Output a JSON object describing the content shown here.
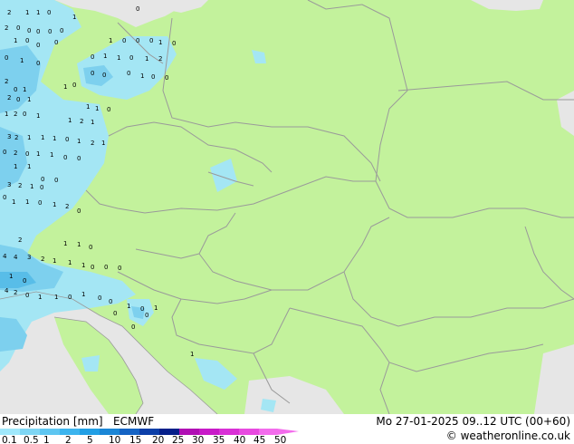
{
  "footer": {
    "title": "Precipitation [mm]",
    "model": "ECMWF",
    "forecast_time": "Mo 27-01-2025 09..12 UTC (00+60)",
    "credit": "© weatheronline.co.uk"
  },
  "legend": {
    "ticks": [
      "0.1",
      "0.5",
      "1",
      "2",
      "5",
      "10",
      "15",
      "20",
      "25",
      "30",
      "35",
      "40",
      "45",
      "50"
    ],
    "colors": [
      "#9fe8fb",
      "#7fd6f4",
      "#5ec6f1",
      "#3cb4ee",
      "#229fe5",
      "#1a86d6",
      "#1463c4",
      "#0c3fa8",
      "#061f8a",
      "#b00fb4",
      "#c81ac8",
      "#d930d6",
      "#e84ae0",
      "#f36cec"
    ]
  },
  "map": {
    "colors": {
      "land": "#c3f29c",
      "sea": "#e6e6e6",
      "precip_light": "#a4e6f4",
      "precip_mid": "#7dd0ee",
      "precip_heavy": "#58bde8",
      "border": "#9a9a9a"
    }
  },
  "station_values": [
    "2",
    "1",
    "1",
    "0",
    "1",
    "2",
    "0",
    "0",
    "0",
    "0",
    "0",
    "1",
    "0",
    "0",
    "0",
    "0",
    "1",
    "0",
    "0",
    "0",
    "1",
    "0",
    "0",
    "1",
    "1",
    "0",
    "1",
    "2",
    "0",
    "1",
    "0",
    "1",
    "0",
    "0",
    "0",
    "0",
    "1",
    "0",
    "0",
    "2",
    "0",
    "1",
    "2",
    "0",
    "1",
    "1",
    "1",
    "0",
    "1",
    "2",
    "0",
    "1",
    "1",
    "2",
    "1",
    "3",
    "2",
    "1",
    "1",
    "1",
    "0",
    "1",
    "2",
    "1",
    "0",
    "2",
    "0",
    "1",
    "1",
    "0",
    "0",
    "1",
    "1",
    "0",
    "0",
    "3",
    "2",
    "1",
    "0",
    "0",
    "1",
    "1",
    "0",
    "1",
    "2",
    "0",
    "2",
    "1",
    "1",
    "0",
    "4",
    "4",
    "3",
    "2",
    "1",
    "1",
    "1",
    "0",
    "0",
    "0",
    "1",
    "0",
    "4",
    "2",
    "0",
    "1",
    "1",
    "0",
    "1",
    "0",
    "0",
    "1",
    "0",
    "1",
    "0",
    "0",
    "0",
    "1"
  ]
}
